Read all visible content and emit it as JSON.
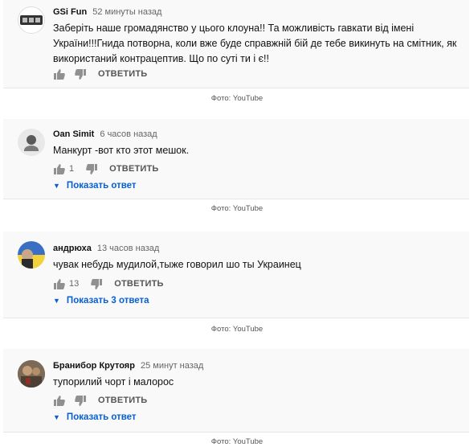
{
  "reply_label": "ОТВЕТИТЬ",
  "photo_caption": "Фото: YouTube",
  "comments": [
    {
      "author": "GSi Fun",
      "time": "52 минуты назад",
      "text": "Заберіть наше громадянство у цього клоуна!! Та можливість гавкати від імені України!!!Гнида потворна, коли вже буде справжній бій де тебе викинуть на смітник, як використаний контрацептив. Що по суті ти і є!!",
      "likes": "",
      "avatar_icon": "gsi-logo-avatar",
      "replies_label": ""
    },
    {
      "author": "Oan Simit",
      "time": "6 часов назад",
      "text": "Манкурт -вот кто этот мешок.",
      "likes": "1",
      "avatar_icon": "grey-circle-avatar",
      "replies_label": "Показать ответ"
    },
    {
      "author": "андрюха",
      "time": "13 часов назад",
      "text": "чувак небудь мудилой,тыже говорил шо ты Украинец",
      "likes": "13",
      "avatar_icon": "ukraine-flag-avatar",
      "replies_label": "Показать 3 ответа"
    },
    {
      "author": "Бранибор Крутояр",
      "time": "25 минут назад",
      "text": "тупорилий чорт і малорос",
      "likes": "",
      "avatar_icon": "painting-avatar",
      "replies_label": "Показать ответ"
    }
  ],
  "colors": {
    "link": "#065fd4",
    "panel": "#f9f9f9",
    "meta": "#666666"
  }
}
